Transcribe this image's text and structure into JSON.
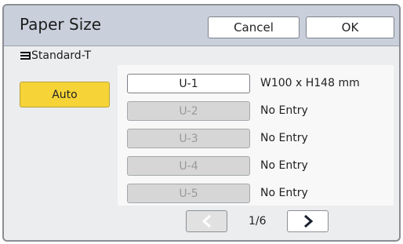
{
  "header": {
    "title": "Paper Size",
    "cancel_label": "Cancel",
    "ok_label": "OK"
  },
  "section": {
    "icon": "list-icon",
    "label": "Standard-T"
  },
  "auto_label": "Auto",
  "slots": [
    {
      "label": "U-1",
      "size": "W100 x H148 mm",
      "enabled": true
    },
    {
      "label": "U-2",
      "size": "No Entry",
      "enabled": false
    },
    {
      "label": "U-3",
      "size": "No Entry",
      "enabled": false
    },
    {
      "label": "U-4",
      "size": "No Entry",
      "enabled": false
    },
    {
      "label": "U-5",
      "size": "No Entry",
      "enabled": false
    }
  ],
  "pagination": {
    "page_text": "1/6",
    "prev_icon": "chevron-left-icon",
    "next_icon": "chevron-right-icon",
    "prev_enabled": false,
    "next_enabled": true
  },
  "colors": {
    "header_bg": "#c9d0dc",
    "auto_button": "#f6d437",
    "disabled_slot": "#d6d6d6"
  }
}
